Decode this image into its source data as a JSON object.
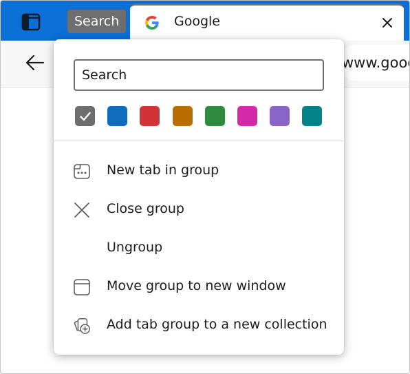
{
  "tab_strip": {
    "group_label": "Search",
    "workspace_icon": "workspaces-icon",
    "active_tab": {
      "title": "Google",
      "favicon": "google-favicon-icon",
      "close_icon": "close-icon"
    }
  },
  "toolbar": {
    "back_icon": "back-arrow-icon",
    "address_text": "www.goog"
  },
  "group_menu": {
    "name_input": {
      "value": "Search",
      "placeholder": ""
    },
    "colors": [
      {
        "name": "grey",
        "hex": "#6e6e6e",
        "selected": true
      },
      {
        "name": "blue",
        "hex": "#0f6cbd",
        "selected": false
      },
      {
        "name": "red",
        "hex": "#d13438",
        "selected": false
      },
      {
        "name": "orange",
        "hex": "#b86e00",
        "selected": false
      },
      {
        "name": "green",
        "hex": "#2d8a3e",
        "selected": false
      },
      {
        "name": "pink",
        "hex": "#d52aa7",
        "selected": false
      },
      {
        "name": "purple",
        "hex": "#8764c6",
        "selected": false
      },
      {
        "name": "teal",
        "hex": "#038387",
        "selected": false
      }
    ],
    "items": [
      {
        "label": "New tab in group",
        "icon": "new-tab-icon"
      },
      {
        "label": "Close group",
        "icon": "close-icon"
      },
      {
        "label": "Ungroup",
        "icon": ""
      },
      {
        "label": "Move group to new window",
        "icon": "window-icon"
      },
      {
        "label": "Add tab group to a new collection",
        "icon": "add-collection-icon"
      }
    ]
  }
}
